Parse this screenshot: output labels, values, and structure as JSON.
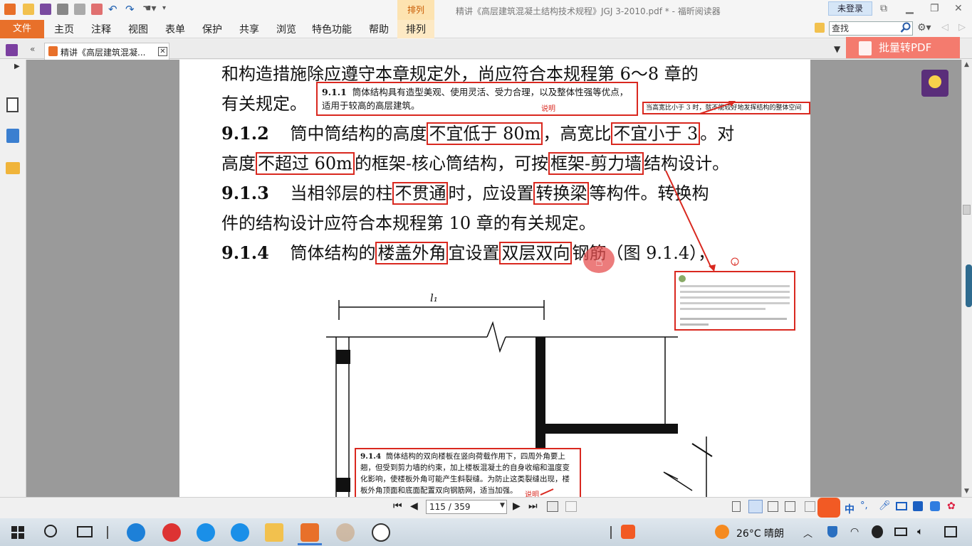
{
  "window": {
    "title": "精讲《高层建筑混凝土结构技术规程》JGJ 3-2010.pdf * - 福昕阅读器",
    "login": "未登录"
  },
  "ribbon": {
    "file": "文件",
    "context_tab": "排列",
    "menu": [
      "主页",
      "注释",
      "视图",
      "表单",
      "保护",
      "共享",
      "浏览",
      "特色功能",
      "帮助",
      "排列"
    ],
    "search_placeholder": "查找"
  },
  "tabs": {
    "doc_tab_label": "精讲《高层建筑混凝..."
  },
  "batch_button": "批量转PDF",
  "document": {
    "line1": "和构造措施除应遵守本章规定外，尚应符合本规程第 6～8 章的",
    "line2": "有关规定。",
    "l3_num": "9.1.2",
    "l3_a": "筒中筒结构的高度",
    "l3_h1": "不宜低于 80m",
    "l3_b": "，高宽比",
    "l3_h2": "不宜小于 3",
    "l3_c": "。对",
    "l4_a": "高度",
    "l4_h1": "不超过 60m",
    "l4_b": "的框架-核心筒结构，可按",
    "l4_h2": "框架-剪力墙",
    "l4_c": "结构设计。",
    "l5_num": "9.1.3",
    "l5_a": "当相邻层的柱",
    "l5_h1": "不贯通",
    "l5_b": "时，应设置",
    "l5_h2": "转换梁",
    "l5_c": "等构件。转换构",
    "line6": "件的结构设计应符合本规程第 10 章的有关规定。",
    "l7_num": "9.1.4",
    "l7_a": "筒体结构的",
    "l7_h1": "楼盖外角",
    "l7_b": "宜设置",
    "l7_h2": "双层双向",
    "l7_c": "钢筋（图 9.1.4），",
    "dim_label": "l₁"
  },
  "notes": {
    "n1_num": "9.1.1",
    "n1_text": "筒体结构具有造型美观、使用灵活、受力合理，以及整体性强等优点，适用于较高的高层建筑。",
    "n1_label": "说明",
    "n2_text": "当高宽比小于 3 时，就不能较好地发挥结构的整体空间",
    "n4_num": "9.1.4",
    "n4_text": "筒体结构的双向楼板在竖向荷载作用下，四周外角要上翘，但受到剪力墙的约束，加上楼板混凝土的自身收缩和温度变化影响，使楼板外角可能产生斜裂缝。为防止这类裂缝出现，楼板外角顶面和底面配置双向钢筋网，适当加强。",
    "n4_label": "说明"
  },
  "statusbar": {
    "page": "115 / 359"
  },
  "taskbar": {
    "weather": "26°C  晴朗",
    "ime": "中"
  },
  "colors": {
    "accent": "#e8702a",
    "annotation": "#d9281f",
    "batch": "#f47b6e"
  }
}
